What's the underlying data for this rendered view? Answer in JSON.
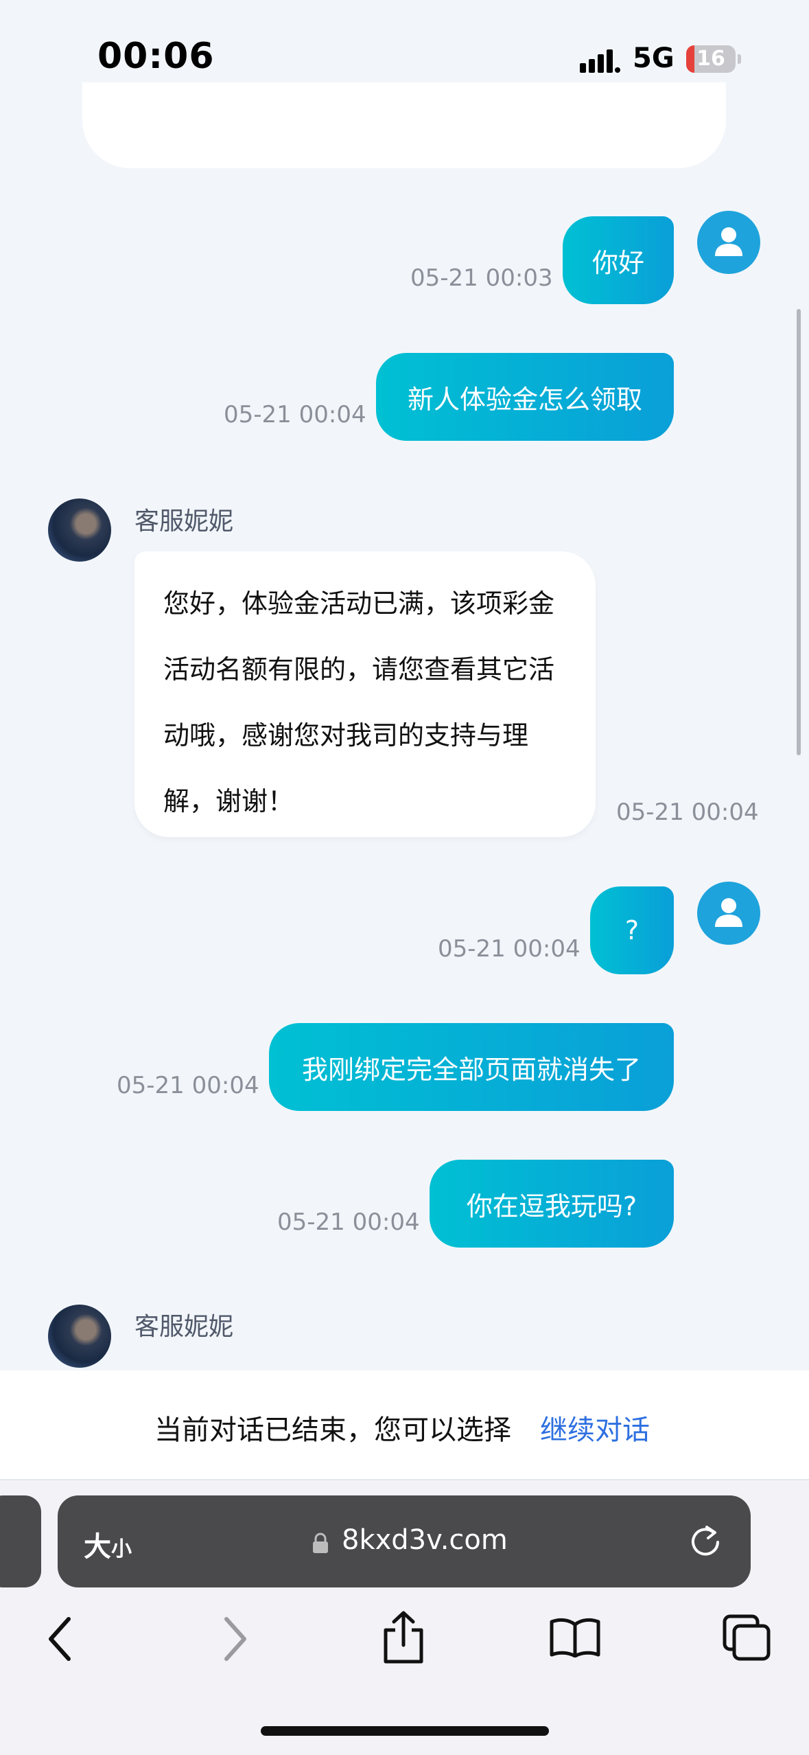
{
  "status_bar": {
    "time": "00:06",
    "network": "5G",
    "battery": "16"
  },
  "messages": {
    "m1": {
      "text": "你好",
      "time": "05-21 00:03"
    },
    "m2": {
      "text": "新人体验金怎么领取",
      "time": "05-21 00:04"
    },
    "agent_reply": {
      "name": "客服妮妮",
      "lines": [
        "您好，体验金活动已满，该项彩金",
        "活动名额有限的，请您查看其它活",
        "动哦，感谢您对我司的支持与理",
        "解，谢谢！"
      ],
      "time": "05-21 00:04"
    },
    "m3": {
      "text": "?",
      "time": "05-21 00:04"
    },
    "m4": {
      "text": "我刚绑定完全部页面就消失了",
      "time": "05-21 00:04"
    },
    "m5": {
      "text": "你在逗我玩吗?",
      "time": "05-21 00:04"
    },
    "agent_next": {
      "name": "客服妮妮"
    }
  },
  "ended_notice": {
    "text": "当前对话已结束，您可以选择",
    "link": "继续对话"
  },
  "browser": {
    "text_size": "大",
    "text_size_small": "小",
    "url": "8kxd3v.com"
  },
  "colors": {
    "bubble_start": "#00c0d3",
    "bubble_end": "#0a9fd8",
    "link": "#2d6fe0"
  }
}
